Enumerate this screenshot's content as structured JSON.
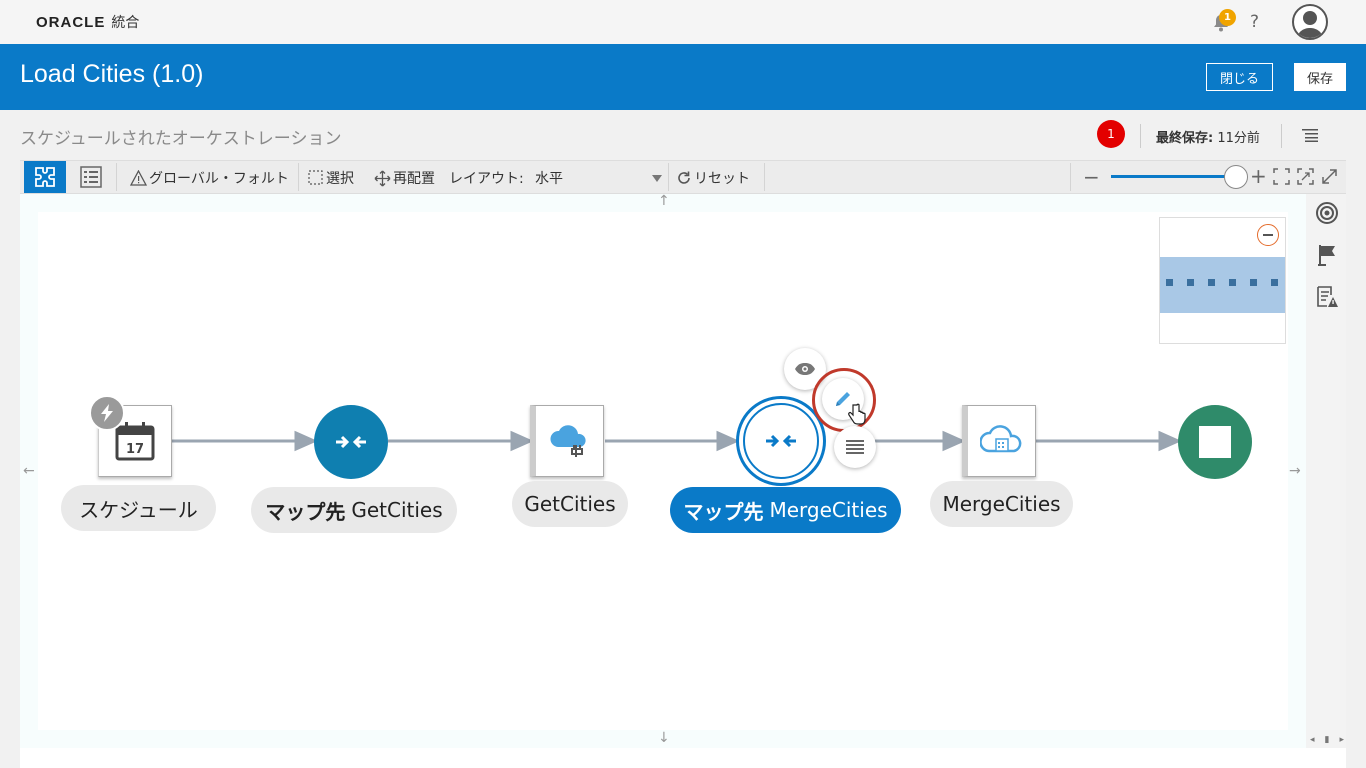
{
  "brand": {
    "vendor": "ORACLE",
    "product": "統合"
  },
  "header": {
    "notification_count": "1",
    "help": "?"
  },
  "titlebar": {
    "title": "Load Cities (1.0)",
    "close_label": "閉じる",
    "save_label": "保存"
  },
  "subheader": {
    "subtitle": "スケジュールされたオーケストレーション",
    "error_count": "1",
    "last_saved_label": "最終保存:",
    "last_saved_value": " 11分前"
  },
  "toolbar": {
    "global_fault": "グローバル・フォルト",
    "select": "選択",
    "reposition": "再配置",
    "layout_label": "レイアウト:",
    "layout_value": "水平",
    "reset": "リセット",
    "zoom_level": 0.95
  },
  "flow": {
    "nodes": [
      {
        "label": "スケジュール",
        "type": "schedule",
        "calendar_day": "17"
      },
      {
        "label_bold": "マップ先",
        "label": "GetCities",
        "type": "map"
      },
      {
        "label": "GetCities",
        "type": "adapter-invoke"
      },
      {
        "label_bold": "マップ先",
        "label": "MergeCities",
        "type": "map",
        "selected": true
      },
      {
        "label": "MergeCities",
        "type": "adapter-invoke"
      },
      {
        "label": "",
        "type": "end"
      }
    ]
  },
  "colors": {
    "accent": "#0a7ac8",
    "map": "#0f7fb0",
    "end": "#2f8b6a",
    "error": "#e30000",
    "highlight": "#c0392b"
  }
}
